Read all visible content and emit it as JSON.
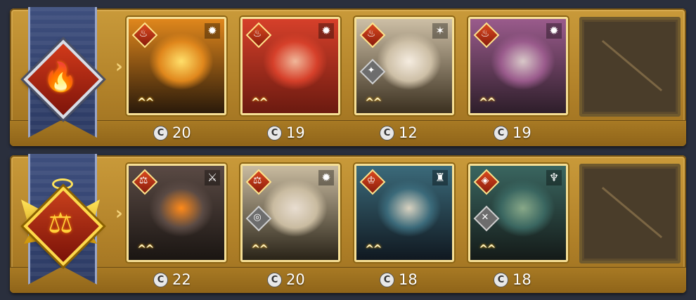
{
  "colors": {
    "panel": "#b3832a",
    "card_border": "#f6df95",
    "banner_blue": "#3e4f7e"
  },
  "rows": [
    {
      "badge_icon": "fire-emblem-icon",
      "badge_glyph": "🔥",
      "cards": [
        {
          "faction_glyph": "♨",
          "role_glyph": "✹",
          "secondary": false,
          "cost": "20",
          "portrait": [
            "#2a1a0a",
            "#e0871c",
            "#ffdf6a"
          ]
        },
        {
          "faction_glyph": "♨",
          "role_glyph": "✹",
          "secondary": false,
          "cost": "19",
          "portrait": [
            "#6b1a10",
            "#d6402a",
            "#f0b79a"
          ]
        },
        {
          "faction_glyph": "♨",
          "role_glyph": "✶",
          "secondary": true,
          "secondary_glyph": "✦",
          "cost": "12",
          "portrait": [
            "#3b3020",
            "#cdbfa6",
            "#f5ece0"
          ]
        },
        {
          "faction_glyph": "♨",
          "role_glyph": "✹",
          "secondary": false,
          "cost": "19",
          "portrait": [
            "#2e1e2a",
            "#9a5b8c",
            "#d8c8c8"
          ]
        }
      ]
    },
    {
      "badge_icon": "justice-scales-emblem-icon",
      "badge_glyph": "⚖",
      "cards": [
        {
          "faction_glyph": "⚖",
          "role_glyph": "⚔",
          "secondary": false,
          "cost": "22",
          "portrait": [
            "#1a1512",
            "#5a4a44",
            "#ff8a1a"
          ]
        },
        {
          "faction_glyph": "⚖",
          "role_glyph": "✹",
          "secondary": true,
          "secondary_glyph": "◎",
          "cost": "20",
          "portrait": [
            "#2a2418",
            "#c9bba0",
            "#e8ddd0"
          ]
        },
        {
          "faction_glyph": "♔",
          "role_glyph": "♜",
          "secondary": false,
          "cost": "18",
          "portrait": [
            "#101820",
            "#3b6a7a",
            "#d9d2c0"
          ]
        },
        {
          "faction_glyph": "◈",
          "role_glyph": "♆",
          "secondary": true,
          "secondary_glyph": "✕",
          "cost": "18",
          "portrait": [
            "#141a18",
            "#3a6660",
            "#88a888"
          ]
        }
      ]
    }
  ],
  "coin_glyph": "C"
}
